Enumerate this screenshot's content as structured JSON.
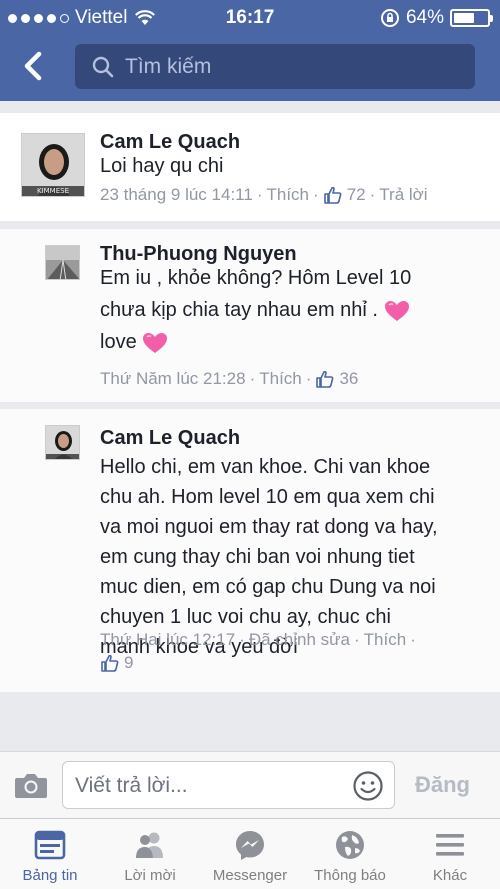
{
  "status_bar": {
    "carrier": "Viettel",
    "time": "16:17",
    "battery_percent": "64%",
    "battery_level": 0.64
  },
  "header": {
    "search_placeholder": "Tìm kiếm"
  },
  "comments": [
    {
      "author": "Cam Le Quach",
      "text": "Loi hay qu chi",
      "time": "23 tháng 9 lúc 14:11",
      "like_action": "Thích",
      "likes": "72",
      "reply_action": "Trả lời"
    },
    {
      "author": "Thu-Phuong Nguyen",
      "text_line1": "Em iu , khỏe không? Hôm Level 10",
      "text_line2": "chưa kịp chia tay nhau em nhỉ .",
      "text_line3": "love",
      "time": "Thứ Năm lúc 21:28",
      "like_action": "Thích",
      "likes": "36"
    },
    {
      "author": "Cam Le Quach",
      "lines": [
        "Hello chi, em van khoe. Chi van khoe",
        "chu ah. Hom level 10 em qua xem chi",
        "va moi nguoi em thay rat dong va hay,",
        "em cung thay chi ban voi nhung tiet",
        "muc dien, em có gap chu Dung va noi",
        "chuyen 1 luc voi chu ay, chuc chi",
        "manh khoe va yeu đời"
      ],
      "time": "Thứ Hai lúc 12:17",
      "edited": "Đã chỉnh sửa",
      "like_action": "Thích",
      "likes": "9"
    }
  ],
  "reply_bar": {
    "placeholder": "Viết trả lời...",
    "post_label": "Đăng"
  },
  "tabs": [
    {
      "label": "Bảng tin",
      "icon": "news-feed-icon",
      "active": true
    },
    {
      "label": "Lời mời",
      "icon": "friend-requests-icon"
    },
    {
      "label": "Messenger",
      "icon": "messenger-icon"
    },
    {
      "label": "Thông báo",
      "icon": "globe-icon"
    },
    {
      "label": "Khác",
      "icon": "menu-icon"
    }
  ],
  "colors": {
    "brand": "#4a66a5",
    "heart": "#f25fa8"
  },
  "avatar_caption": "KIMMESE"
}
